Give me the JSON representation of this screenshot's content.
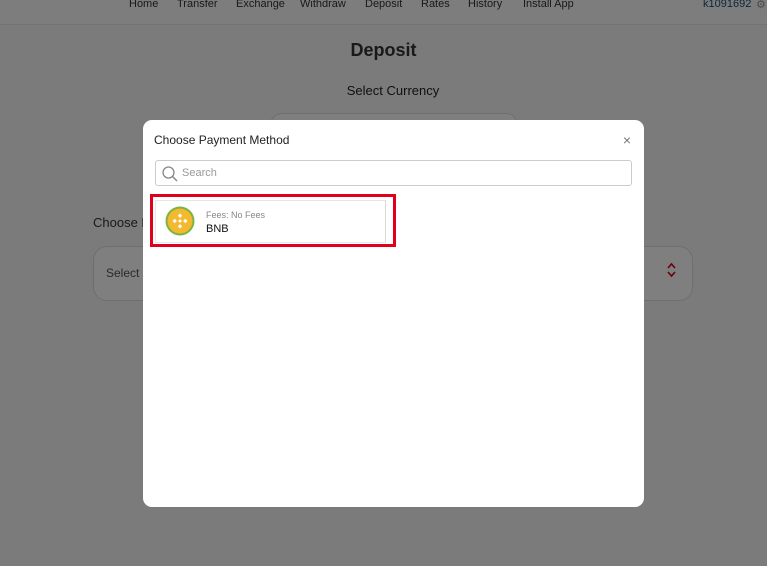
{
  "nav": {
    "items": [
      "Home",
      "Transfer",
      "Exchange",
      "Withdraw",
      "Deposit",
      "Rates",
      "History",
      "Install App"
    ],
    "user": "k1091692"
  },
  "page": {
    "title": "Deposit",
    "select_currency_label": "Select Currency",
    "choose_label": "Choose P",
    "payment_select_placeholder": "Select P"
  },
  "modal": {
    "title": "Choose Payment Method",
    "close_glyph": "×",
    "search_placeholder": "Search",
    "methods": [
      {
        "fees": "Fees: No Fees",
        "name": "BNB",
        "icon": "bnb-coin-icon"
      }
    ]
  },
  "colors": {
    "highlight": "#e0001a",
    "bnb_yellow": "#f3ba2f",
    "bnb_green": "#7cb342",
    "accent_red": "#d0021b"
  }
}
